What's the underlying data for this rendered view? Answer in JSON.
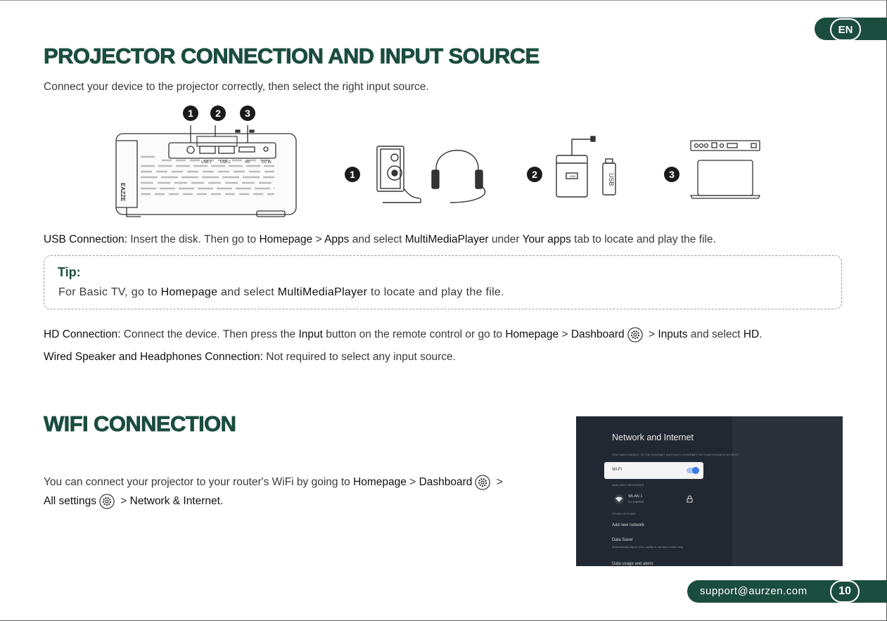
{
  "lang": "EN",
  "section1": {
    "title": "PROJECTOR CONNECTION AND INPUT SOURCE",
    "intro": "Connect your device to the projector correctly, then select the right input source."
  },
  "figure": {
    "markers": [
      "1",
      "2",
      "3"
    ],
    "port_labels": [
      "USB-1",
      "USB-2",
      "HD",
      "DC IN"
    ],
    "brand": "EAZZE",
    "usb_stick_label": "USB",
    "drive_label": "USB"
  },
  "usb_connection": {
    "label": "USB Connection:",
    "t1": " Insert the disk. Then go to ",
    "homepage": "Homepage",
    "gt1": " > ",
    "apps": "Apps",
    "t2": " and select ",
    "player": "MultiMediaPlayer",
    "t3": " under ",
    "your_apps": "Your apps",
    "t4": " tab to locate and play the file."
  },
  "tip": {
    "title": "Tip:",
    "t1": "For Basic TV, go to ",
    "homepage": "Homepage",
    "t2": " and select ",
    "player": "MultiMediaPlayer",
    "t3": " to locate and play the file."
  },
  "hd_connection": {
    "label": "HD Connection:",
    "t1": " Connect the device. Then press the ",
    "input": "Input",
    "t2": " button on the remote control or go to ",
    "homepage": "Homepage",
    "gt1": " > ",
    "dashboard": "Dashboard",
    "gt2": " > ",
    "inputs": "Inputs",
    "t3": " and select ",
    "hd": "HD",
    "t4": "."
  },
  "wired": {
    "label": "Wired Speaker and Headphones Connection:",
    "t1": " Not required to select any input source."
  },
  "section2": {
    "title": "WIFI CONNECTION",
    "t1": "You can connect your projector to your router's WiFi by going to ",
    "homepage": "Homepage",
    "gt1": " > ",
    "dashboard": "Dashboard",
    "gt2": " >",
    "all_settings": "All settings",
    "gt3": " > ",
    "network": "Network & Internet",
    "t2": "."
  },
  "tv_screen": {
    "title": "Network and Internet",
    "subtitle": "YOU CAN CONNECT TO THE INTERNET WITH WI-FI, ETHERNET OR YOUR PHONE'S HOTSPOT.",
    "wifi_label": "Wi-Fi",
    "available_header": "AVAILABLE NETWORKS",
    "network_name": "WLAN 1",
    "network_status": "No Internet",
    "other_header": "OTHER OPTIONS",
    "add_network": "Add new network",
    "data_saver": "Data Saver",
    "data_saver_desc": "Automatically adjust video quality to use less mobile data",
    "data_usage": "Data usage and alerts"
  },
  "footer": {
    "email": "support@aurzen.com",
    "page": "10"
  },
  "colors": {
    "brand_green": "#1b4d3e",
    "tv_background": "#222831",
    "toggle_on": "#3d7be8"
  }
}
